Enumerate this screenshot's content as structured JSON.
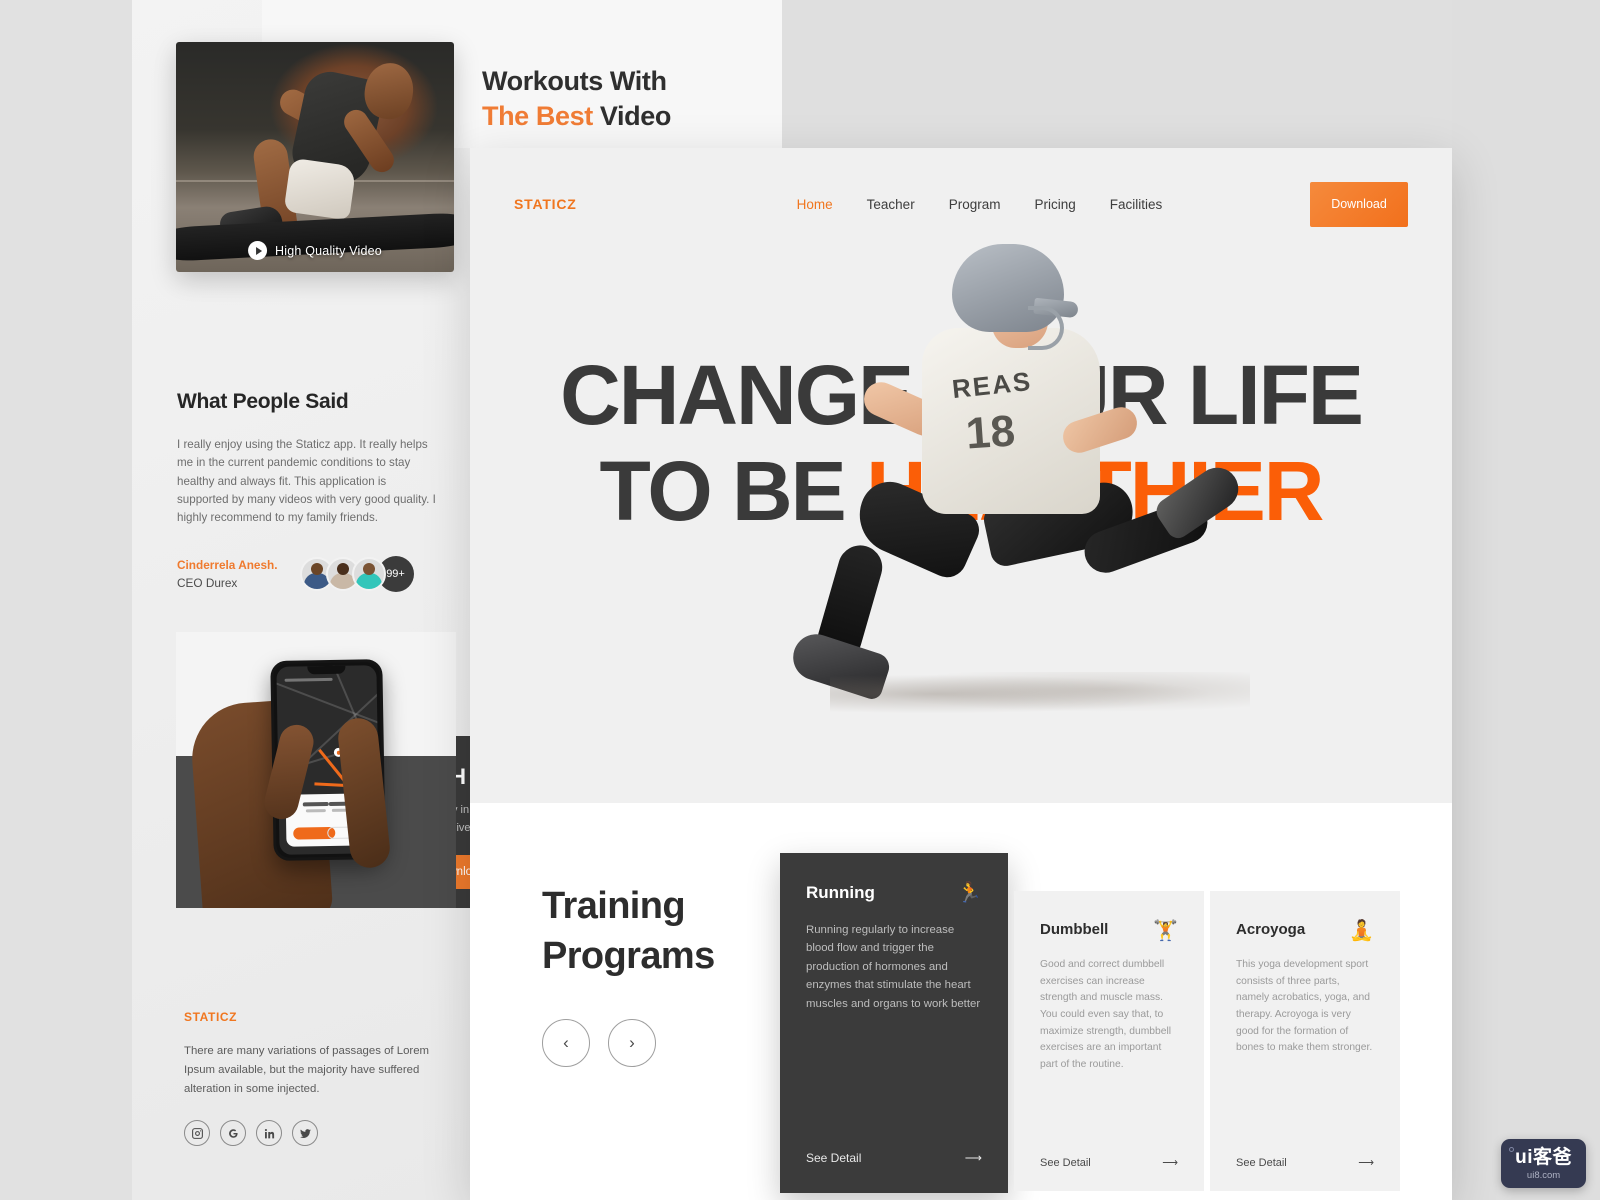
{
  "teaser": {
    "line1": "Workouts With",
    "line2_accent": "The Best",
    "line2_rest": " Video"
  },
  "video_card": {
    "badge_label": "High Quality Video",
    "play_icon": "play-circle-icon"
  },
  "testimonial": {
    "heading": "What People Said",
    "quote": "I really enjoy using the Staticz app. It really helps me in the current pandemic conditions to stay healthy and always fit. This application is supported by many videos with very good quality. I highly recommend to my family friends.",
    "author_name": "Cinderrela Anesh.",
    "author_role": "CEO Durex",
    "avatar_count_label": "99+"
  },
  "promo": {
    "title": "Live H",
    "line1": "Enjoy many in",
    "line2": "Try now to live",
    "button_label": "Download N"
  },
  "footer": {
    "logo": "STATICZ",
    "text": "There are many variations of passages of Lorem Ipsum available, but the majority have suffered alteration in some injected.",
    "socials": [
      {
        "name": "instagram-icon"
      },
      {
        "name": "google-icon"
      },
      {
        "name": "linkedin-icon"
      },
      {
        "name": "twitter-icon"
      }
    ]
  },
  "nav": {
    "brand": "STATICZ",
    "items": [
      {
        "label": "Home",
        "active": true
      },
      {
        "label": "Teacher",
        "active": false
      },
      {
        "label": "Program",
        "active": false
      },
      {
        "label": "Pricing",
        "active": false
      },
      {
        "label": "Facilities",
        "active": false
      }
    ],
    "download_label": "Download"
  },
  "hero": {
    "line1": "CHANGE YOUR LIFE",
    "line2_plain": "TO BE ",
    "line2_accent": "HEALTHIER",
    "jersey_text": "REAS",
    "jersey_number": "18"
  },
  "programs": {
    "heading_line1": "Training",
    "heading_line2": "Programs",
    "prev_icon": "chevron-left-icon",
    "next_icon": "chevron-right-icon",
    "cards": [
      {
        "title": "Running",
        "emoji": "🏃",
        "icon_name": "running-icon",
        "body": "Running regularly to increase blood flow and trigger the production of hormones and enzymes that stimulate the heart muscles and organs to work better",
        "link_label": "See Detail"
      },
      {
        "title": "Dumbbell",
        "emoji": "🏋️",
        "icon_name": "weightlifter-icon",
        "body": "Good and correct dumbbell exercises can increase strength and muscle mass. You could even say that, to maximize strength, dumbbell exercises are an important part of the routine.",
        "link_label": "See Detail"
      },
      {
        "title": "Acroyoga",
        "emoji": "🧘",
        "icon_name": "yoga-icon",
        "body": "This yoga development sport consists of three parts, namely acrobatics, yoga, and therapy. Acroyoga is very good for the formation of bones to make them stronger.",
        "link_label": "See Detail"
      }
    ]
  },
  "watermark": {
    "main": "ui客爸",
    "sub": "ui8.com"
  },
  "colors": {
    "accent": "#f0761f",
    "accent_bright": "#fb5e07",
    "dark": "#3b3b3b",
    "hero_bg": "#f0f0f0"
  }
}
